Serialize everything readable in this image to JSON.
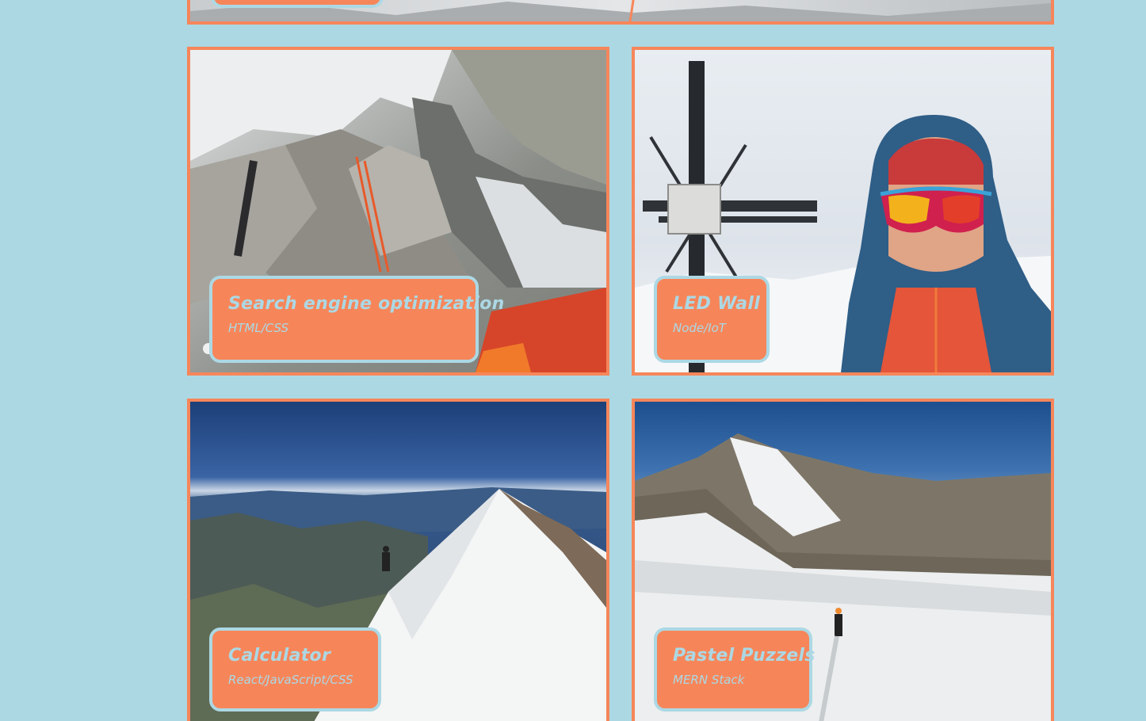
{
  "projects": [
    {
      "title": "Search engine optimization",
      "stack": "HTML/CSS"
    },
    {
      "title": "LED Wall",
      "stack": "Node/IoT"
    },
    {
      "title": "Calculator",
      "stack": "React/JavaScript/CSS"
    },
    {
      "title": "Pastel Puzzels",
      "stack": "MERN Stack"
    }
  ],
  "colors": {
    "background": "#acd8e4",
    "accent": "#f6865a",
    "label_text": "#acd8e4"
  }
}
